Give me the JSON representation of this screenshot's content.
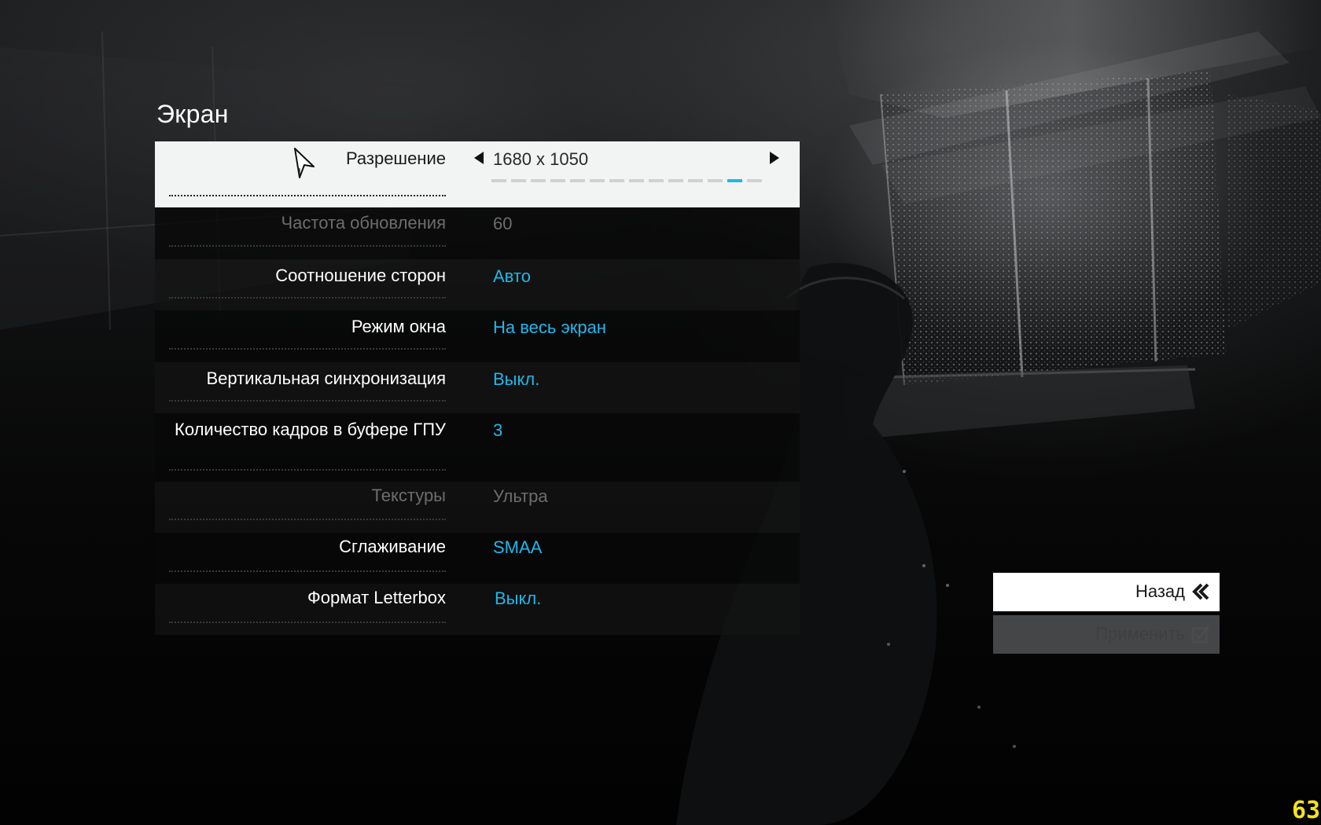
{
  "screen": {
    "title": "Экран"
  },
  "settings": [
    {
      "label": "Разрешение",
      "value": "1680 x 1050",
      "state": "selected",
      "slider_total": 14,
      "slider_index": 12
    },
    {
      "label": "Частота обновления",
      "value": "60",
      "state": "disabled"
    },
    {
      "label": "Соотношение сторон",
      "value": "Авто",
      "state": "enabled"
    },
    {
      "label": "Режим окна",
      "value": "На весь экран",
      "state": "enabled"
    },
    {
      "label": "Вертикальная синхронизация",
      "value": "Выкл.",
      "state": "enabled"
    },
    {
      "label": "Количество кадров в буфере ГПУ",
      "value": "3",
      "state": "enabled"
    },
    {
      "label": "Текстуры",
      "value": "Ультра",
      "state": "disabled"
    },
    {
      "label": "Сглаживание",
      "value": "SMAA",
      "state": "enabled"
    },
    {
      "label": "Формат Letterbox",
      "value": "Выкл.",
      "state": "enabled"
    }
  ],
  "buttons": {
    "back_label": "Назад",
    "apply_label": "Применить"
  },
  "fps_counter": "63",
  "colors": {
    "accent": "#1fb8ea",
    "disabled_text": "#6d6d6d",
    "selected_row_bg": "#f2f3f3",
    "fps_color": "#f4e21c"
  },
  "icons": {
    "cursor": "arrow-cursor-icon",
    "prev": "arrow-left-icon",
    "next": "arrow-right-icon",
    "back": "double-chevron-left-icon",
    "apply": "checkbox-icon"
  }
}
